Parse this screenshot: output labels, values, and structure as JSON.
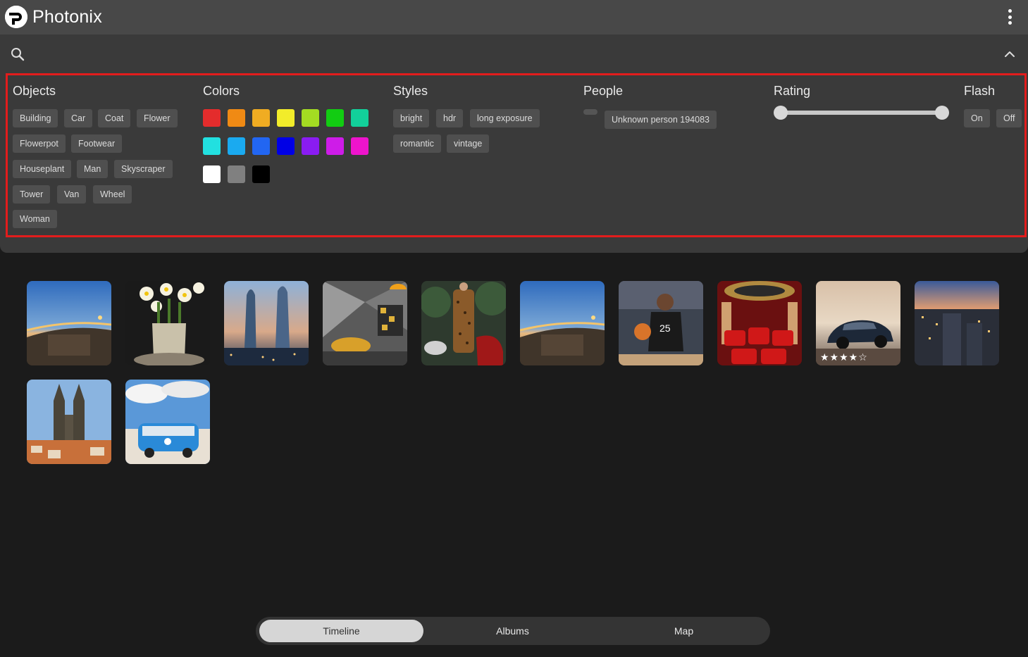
{
  "app": {
    "title": "Photonix"
  },
  "icons": {
    "logo": "photonix-logo-icon",
    "menu": "more-vert-icon",
    "search": "search-icon",
    "collapse": "chevron-up-icon"
  },
  "filters": {
    "objects": {
      "title": "Objects",
      "items": [
        "Building",
        "Car",
        "Coat",
        "Flower",
        "Flowerpot",
        "Footwear",
        "Houseplant",
        "Man",
        "Skyscraper",
        "Tower",
        "Van",
        "Wheel",
        "Woman"
      ]
    },
    "colors": {
      "title": "Colors",
      "swatches": [
        "#e42c2c",
        "#f08a14",
        "#f0ac22",
        "#f2ec2a",
        "#a4dc22",
        "#12cc12",
        "#12d09a",
        "#22e0e0",
        "#1aaaf0",
        "#2266f2",
        "#0000e6",
        "#8a1cf2",
        "#ce1ce8",
        "#ee14cc",
        "#ffffff",
        "#808080",
        "#000000"
      ]
    },
    "styles": {
      "title": "Styles",
      "items": [
        "bright",
        "hdr",
        "long exposure",
        "romantic",
        "vintage"
      ]
    },
    "people": {
      "title": "People",
      "items": [
        "Unknown person 194083"
      ]
    },
    "rating": {
      "title": "Rating",
      "min": 0,
      "max": 5
    },
    "flash": {
      "title": "Flash",
      "items": [
        "On",
        "Off"
      ]
    }
  },
  "photos": [
    {
      "name": "bridge-dusk",
      "rating": null
    },
    {
      "name": "daffodils-vase",
      "rating": null
    },
    {
      "name": "twin-towers-skyline",
      "rating": null
    },
    {
      "name": "modern-lounge",
      "rating": null
    },
    {
      "name": "leopard-coat",
      "rating": null
    },
    {
      "name": "bridge-dusk-2",
      "rating": null
    },
    {
      "name": "basketball-player",
      "rating": null
    },
    {
      "name": "red-cinema",
      "rating": null
    },
    {
      "name": "car-sunset",
      "rating": 4,
      "stars_text": "★★★★☆"
    },
    {
      "name": "city-night-aerial",
      "rating": null
    },
    {
      "name": "gothic-church",
      "rating": null
    },
    {
      "name": "blue-van-beach",
      "rating": null
    }
  ],
  "nav": {
    "tabs": [
      "Timeline",
      "Albums",
      "Map"
    ],
    "active": "Timeline"
  }
}
